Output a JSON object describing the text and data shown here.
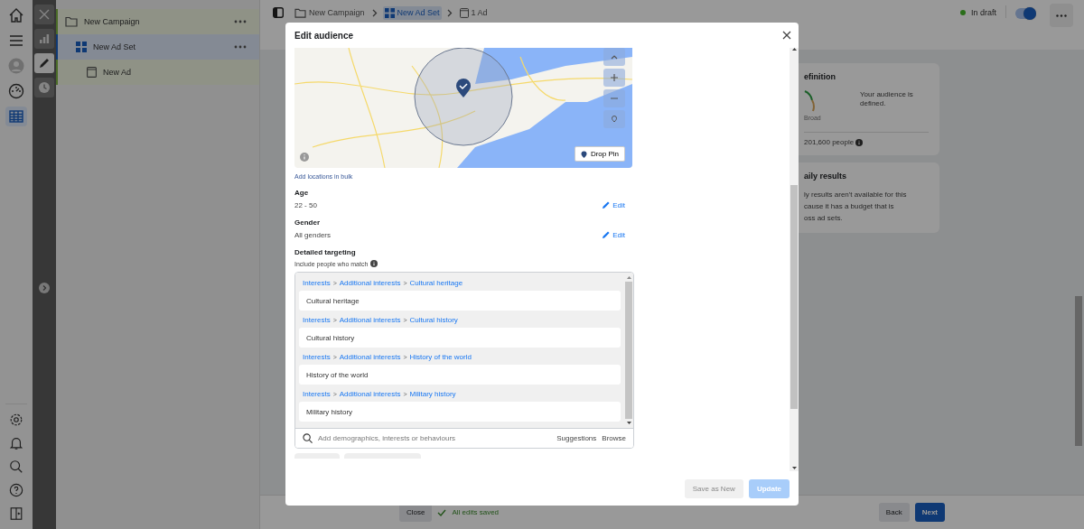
{
  "nav_rail": {
    "top": [
      {
        "kind": "home",
        "selected": false
      },
      {
        "kind": "menu",
        "selected": false
      },
      {
        "kind": "avatar",
        "selected": false
      },
      {
        "kind": "gauge",
        "selected": false
      },
      {
        "kind": "table",
        "selected": true
      }
    ],
    "bottom": [
      {
        "kind": "settings",
        "selected": false
      },
      {
        "kind": "bell",
        "selected": false
      },
      {
        "kind": "search",
        "selected": false
      },
      {
        "kind": "help",
        "selected": false
      },
      {
        "kind": "panel",
        "selected": false
      }
    ]
  },
  "tool_rail": [
    {
      "kind": "close",
      "selected": false
    },
    {
      "kind": "chart",
      "selected": false
    },
    {
      "kind": "pencil",
      "selected": true
    },
    {
      "kind": "clock",
      "selected": false
    }
  ],
  "tree": [
    {
      "label": "New Campaign",
      "kind": "campaign",
      "selected": false,
      "children": [
        {
          "label": "New Ad Set",
          "kind": "ad_set",
          "selected": true,
          "children": [
            {
              "label": "New Ad",
              "kind": "ad",
              "selected": false
            }
          ]
        }
      ]
    }
  ],
  "breadcrumb": [
    {
      "label": "New Campaign",
      "kind": "campaign",
      "selected": false
    },
    {
      "label": "New Ad Set",
      "kind": "ad_set",
      "selected": true
    },
    {
      "label": "1 Ad",
      "kind": "ad",
      "selected": false
    }
  ],
  "status": {
    "label": "In draft",
    "color": "#2a6e1a",
    "toggle_on": true
  },
  "cards": [
    {
      "kind": "definition",
      "title": "efinition",
      "note": "Your audience is defined.",
      "gauge_label": "Broad",
      "size": "201,600 people"
    },
    {
      "kind": "results",
      "title": "aily results",
      "lines": [
        "ly results aren't available for this",
        "cause it has a budget that is",
        "oss ad sets."
      ]
    }
  ],
  "footer": {
    "close": "Close",
    "saved": "All edits saved",
    "back": "Back",
    "next": "Next"
  },
  "modal": {
    "title": "Edit audience",
    "drop_pin": "Drop Pin",
    "bulk_link": "Add locations in bulk",
    "fields": [
      {
        "label": "Age",
        "value": "22 - 50",
        "edit": "Edit"
      },
      {
        "label": "Gender",
        "value": "All genders",
        "edit": "Edit"
      }
    ],
    "targeting": {
      "title": "Detailed targeting",
      "subtitle": "Include people who match",
      "separator": ">",
      "groups": [
        {
          "path": [
            "Interests",
            "Additional interests",
            "Cultural heritage"
          ],
          "item": "Cultural heritage"
        },
        {
          "path": [
            "Interests",
            "Additional interests",
            "Cultural history"
          ],
          "item": "Cultural history"
        },
        {
          "path": [
            "Interests",
            "Additional interests",
            "History of the world"
          ],
          "item": "History of the world"
        },
        {
          "path": [
            "Interests",
            "Additional interests",
            "Military history"
          ],
          "item": "Military history"
        }
      ],
      "placeholder": "Add demographics, interests or behaviours",
      "suggestions": "Suggestions",
      "browse": "Browse"
    },
    "buttons": [
      {
        "label": "Save as New",
        "kind": "secondary",
        "disabled": true
      },
      {
        "label": "Update",
        "kind": "primary",
        "disabled": true
      }
    ]
  }
}
